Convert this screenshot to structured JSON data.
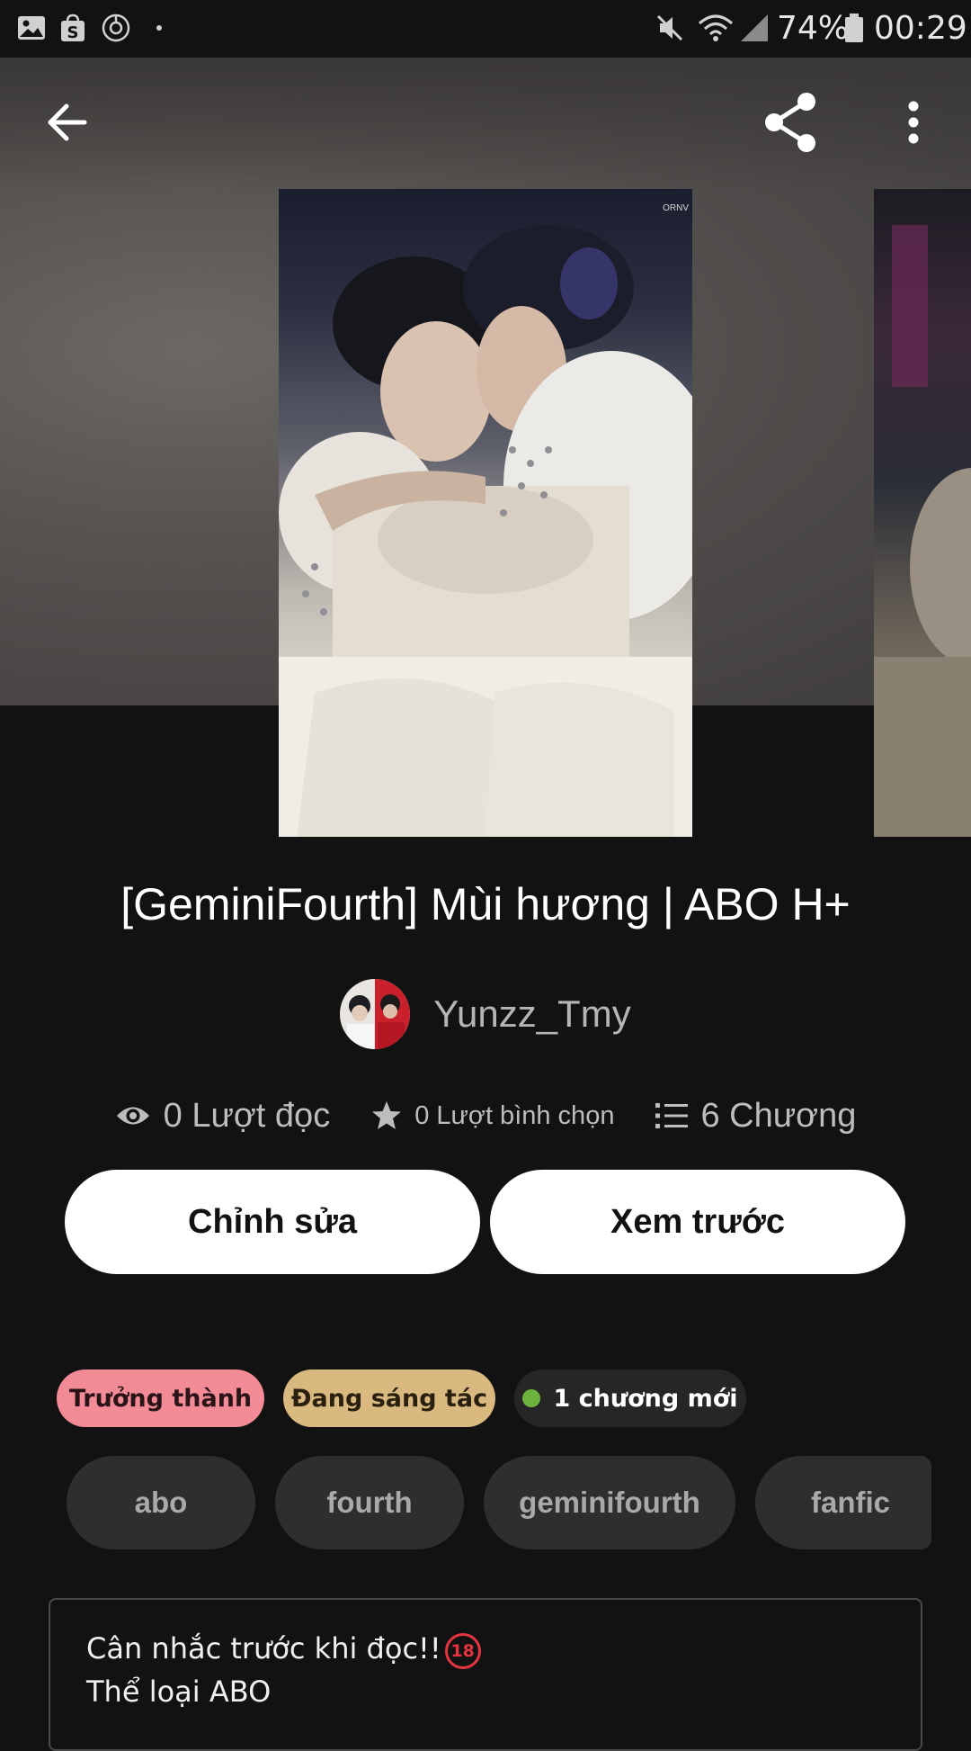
{
  "status_bar": {
    "battery": "74%",
    "time": "00:29",
    "icons": [
      "gallery-icon",
      "shop-icon",
      "sync-icon",
      "dot-icon",
      "mute-icon",
      "wifi-icon",
      "signal-icon",
      "battery-icon"
    ]
  },
  "toolbar": {
    "icons": [
      "back-arrow-icon",
      "share-icon",
      "more-vert-icon"
    ]
  },
  "cover": {
    "watermark": "ORNV"
  },
  "story": {
    "title": "[GeminiFourth] Mùi hương | ABO H+",
    "author": "Yunzz_Tmy"
  },
  "stats": {
    "reads": "0 Lượt đọc",
    "votes": "0 Lượt bình chọn",
    "chapters": "6 Chương"
  },
  "actions": {
    "edit_label": "Chỉnh sửa",
    "preview_label": "Xem trước"
  },
  "badges": {
    "mature": "Trưởng thành",
    "ongoing": "Đang sáng tác",
    "new_chapter": "1 chương mới"
  },
  "tags": [
    "abo",
    "fourth",
    "geminifourth",
    "fanfic"
  ],
  "description": {
    "line1": "Cân nhắc trước khi đọc!!",
    "age_rating": "18",
    "line2": "Thể loại ABO"
  },
  "colors": {
    "background": "#121212",
    "mature_badge": "#f28b95",
    "ongoing_badge": "#d9b980",
    "new_chapter_dot": "#6cb33e",
    "tag_bg": "#2e2e2e",
    "age_rating_red": "#e3343f"
  }
}
